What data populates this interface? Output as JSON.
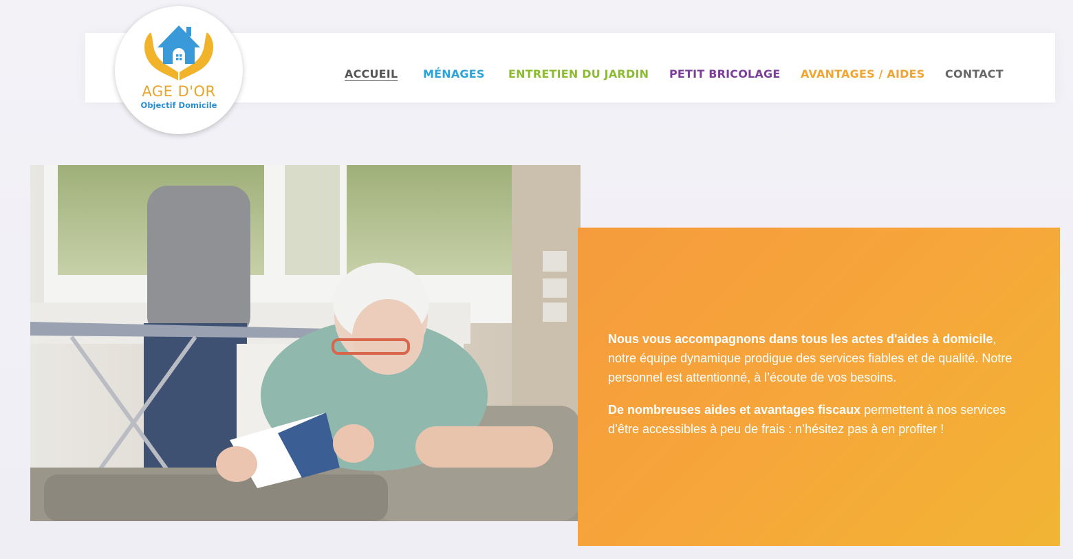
{
  "logo": {
    "brand": "AGE D'OR",
    "tagline": "Objectif Domicile"
  },
  "nav": {
    "items": [
      {
        "label": "ACCUEIL",
        "color": "#555555",
        "active": true
      },
      {
        "label": "MÉNAGES",
        "color": "#2aa4d8",
        "active": false
      },
      {
        "label": "ENTRETIEN DU JARDIN",
        "color": "#8dbb2f",
        "active": false
      },
      {
        "label": "PETIT BRICOLAGE",
        "color": "#7b3f9a",
        "active": false
      },
      {
        "label": "AVANTAGES / AIDES",
        "color": "#f0a432",
        "active": false
      },
      {
        "label": "CONTACT",
        "color": "#666666",
        "active": false
      }
    ]
  },
  "hero": {
    "image_alt_icon": "elderly-woman-reading-photo"
  },
  "intro": {
    "p1_bold": "Nous vous accompagnons dans tous les actes d'aides à domicile",
    "p1_rest": ", notre équipe dynamique prodigue des services fiables et de qualité. Notre personnel est attentionné, à l’écoute de vos besoins.",
    "p2_bold": "De nombreuses aides et avantages fiscaux",
    "p2_rest": " permettent à nos services d’être accessibles à peu de frais : n’hésitez pas à en profiter !"
  },
  "colors": {
    "orange_start": "#f59b3d",
    "orange_end": "#f2b534",
    "logo_blue": "#2b8ed0",
    "logo_gold": "#e8a52a"
  }
}
